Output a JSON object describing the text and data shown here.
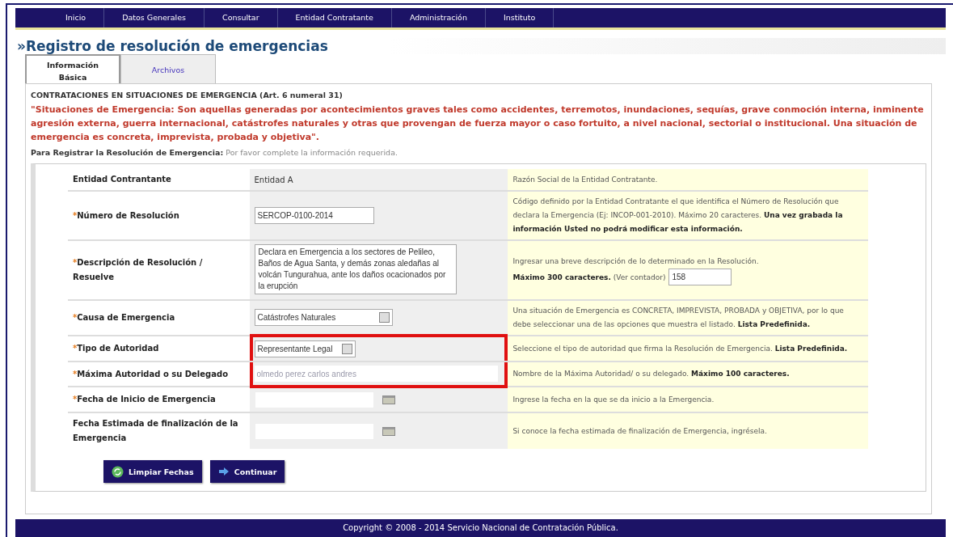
{
  "nav": [
    {
      "label": "Inicio"
    },
    {
      "label": "Datos Generales"
    },
    {
      "label": "Consultar"
    },
    {
      "label": "Entidad Contratante"
    },
    {
      "label": "Administración"
    },
    {
      "label": "Instituto"
    }
  ],
  "title": "»Registro de resolución de emergencias",
  "tabs": [
    {
      "label": "Información Básica",
      "selected": true
    },
    {
      "label": "Archivos",
      "selected": false
    }
  ],
  "intro": {
    "heading": "CONTRATACIONES EN SITUACIONES DE EMERGENCIA (Art. 6 numeral 31)",
    "definition": "\"Situaciones de Emergencia: Son aquellas generadas por acontecimientos graves tales como accidentes, terremotos, inundaciones, sequías, grave conmoción interna, inminente agresión externa, guerra internacional, catástrofes naturales y otras que provengan de fuerza mayor o caso fortuito, a nivel nacional, sectorial o institucional. Una situación de emergencia es concreta, imprevista, probada y objetiva\".",
    "instruction": "**Para Registrar la Resolución de Emergencia:** Por favor complete la información requerida."
  },
  "rows": [
    {
      "kind": "text",
      "label": "Entidad Contrantante",
      "value": "Entidad A",
      "help": "Razón Social de la Entidad Contratante.",
      "highlighted": false
    },
    {
      "kind": "input",
      "marker": "*",
      "label": "Número de Resolución",
      "value": "SERCOP-0100-2014",
      "help": "Código definido por la Entidad Contratante el que identifica el Número de Resolución que declara la Emergencia (Ej: INCOP-001-2010). Máximo 20 caracteres. **Una vez grabada la información Usted no podrá modificar esta información.**",
      "highlighted": false
    },
    {
      "kind": "textarea",
      "marker": "*",
      "label": "Descripción de Resolución / Resuelve",
      "value": "Declara en Emergencia a los sectores de Pelileo, Baños de Agua Santa, y demás zonas aledañas al volcán Tungurahua, ante los daños ocacionados por la erupción",
      "help": "Ingresar una breve descripción de lo determinado en la Resolución.",
      "help2": "**Máximo 300 caracteres.** (Ver contador)",
      "counter": "158",
      "highlighted": false
    },
    {
      "kind": "select",
      "marker": "*",
      "label": "Causa de Emergencia",
      "value": "Catástrofes Naturales",
      "help": "Una situación de Emergencia es CONCRETA, IMPREVISTA, PROBADA y OBJETIVA, por lo que debe seleccionar una de las opciones que muestra el listado. **Lista Predefinida.**",
      "highlighted": false
    },
    {
      "kind": "select",
      "marker": "*",
      "label": "Tipo de Autoridad",
      "value": "Representante Legal",
      "help": "Seleccione el tipo de autoridad que firma la Resolución de Emergencia. **Lista Predefinida.**",
      "highlighted": true
    },
    {
      "kind": "input",
      "marker": "*",
      "label": "Máxima Autoridad o su Delegado",
      "placeholder": "olmedo perez carlos andres",
      "help": "Nombre de la Máxima Autoridad/ o su delegado. **Máximo 100 caracteres.**",
      "highlighted": true
    },
    {
      "kind": "date",
      "marker": "*",
      "label": "Fecha de Inicio de Emergencia",
      "help": "Ingrese la fecha en la que se da inicio a la Emergencia.",
      "highlighted": false
    },
    {
      "kind": "date",
      "label": "Fecha Estimada de finalización de la Emergencia",
      "help": "Si conoce la fecha estimada de finalización de Emergencia, ingrésela.",
      "highlighted": false
    }
  ],
  "buttons": [
    {
      "kind": "clear",
      "label": "Limpiar Fechas"
    },
    {
      "kind": "next",
      "label": "Continuar"
    }
  ],
  "footer": "Copyright © 2008 - 2014 Servicio Nacional de Contratación Pública."
}
